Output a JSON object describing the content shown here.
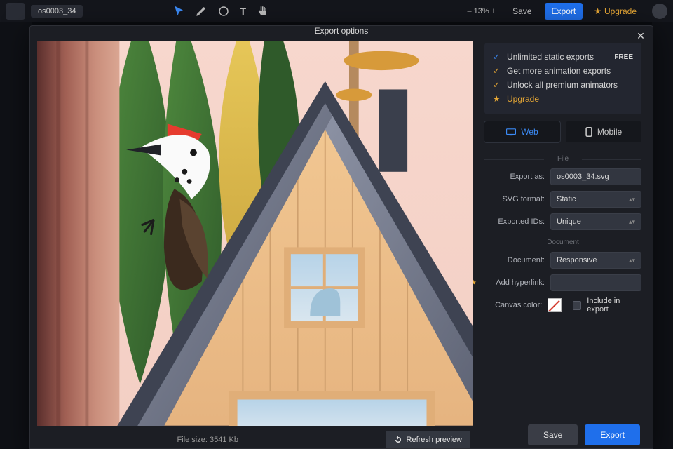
{
  "app": {
    "document_name": "os0003_34",
    "zoom": "13%",
    "top_actions": {
      "save": "Save",
      "export": "Export",
      "upgrade": "Upgrade"
    }
  },
  "modal": {
    "title": "Export options",
    "promo": {
      "line1": "Unlimited static exports",
      "badge": "FREE",
      "line2": "Get more animation exports",
      "line3": "Unlock all premium animators",
      "upgrade": "Upgrade"
    },
    "platform_tabs": {
      "web": "Web",
      "mobile": "Mobile"
    },
    "sections": {
      "file": "File",
      "document": "Document"
    },
    "fields": {
      "export_as": {
        "label": "Export as:",
        "value": "os0003_34.svg"
      },
      "svg_format": {
        "label": "SVG format:",
        "value": "Static"
      },
      "exported_ids": {
        "label": "Exported IDs:",
        "value": "Unique"
      },
      "document": {
        "label": "Document:",
        "value": "Responsive"
      },
      "hyperlink": {
        "label": "Add hyperlink:",
        "value": ""
      },
      "canvas_color": {
        "label": "Canvas color:"
      },
      "include_in_export": "Include in export"
    },
    "preview": {
      "file_size": "File size: 3541 Kb",
      "refresh": "Refresh preview"
    },
    "footer": {
      "save": "Save",
      "export": "Export"
    }
  }
}
